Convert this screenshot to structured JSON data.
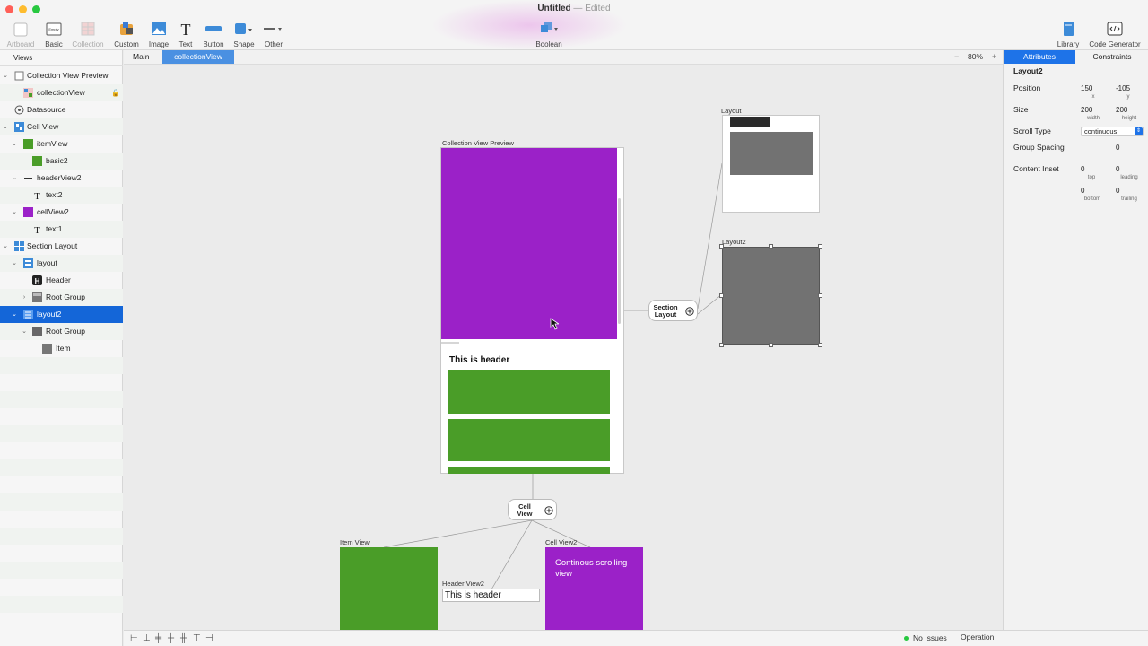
{
  "window": {
    "title": "Untitled",
    "title_sep": "—",
    "status": "Edited"
  },
  "toolbar": {
    "items": [
      {
        "label": "Artboard",
        "icon": "artboard-icon",
        "enabled": false
      },
      {
        "label": "Basic",
        "icon": "basic-icon",
        "enabled": true,
        "icon_text": "Empty"
      },
      {
        "label": "Collection",
        "icon": "collection-icon",
        "enabled": false
      },
      {
        "label": "Custom",
        "icon": "custom-icon",
        "enabled": true
      },
      {
        "label": "Image",
        "icon": "image-icon",
        "enabled": true
      },
      {
        "label": "Text",
        "icon": "text-icon",
        "enabled": true,
        "icon_text": "T"
      },
      {
        "label": "Button",
        "icon": "button-icon",
        "enabled": true
      },
      {
        "label": "Shape",
        "icon": "shape-icon",
        "enabled": true
      },
      {
        "label": "Other",
        "icon": "other-icon",
        "enabled": true
      }
    ],
    "boolean_label": "Boolean",
    "library_label": "Library",
    "codegen_label": "Code Generator"
  },
  "views_panel": {
    "tab_label": "Views",
    "items": [
      {
        "label": "Collection View Preview",
        "icon": "artboard-icon",
        "chevron": "v",
        "alt": false,
        "selected": false
      },
      {
        "label": "collectionView",
        "icon": "collection-icon",
        "lock": "🔒",
        "alt": true,
        "selected": false
      },
      {
        "label": "Datasource",
        "icon": "datasource-icon",
        "alt": false,
        "selected": false
      },
      {
        "label": "Cell View",
        "icon": "cellview-icon",
        "chevron": "v",
        "alt": true,
        "selected": false
      },
      {
        "label": "itemView",
        "icon": "green-square-icon",
        "chevron": "v",
        "alt": false,
        "selected": false
      },
      {
        "label": "basic2",
        "icon": "green-square-icon",
        "alt": true,
        "selected": false
      },
      {
        "label": "headerView2",
        "icon": "line-icon",
        "chevron": "v",
        "alt": false,
        "selected": false
      },
      {
        "label": "text2",
        "icon": "text-icon",
        "alt": true,
        "selected": false
      },
      {
        "label": "cellView2",
        "icon": "purple-square-icon",
        "chevron": "v",
        "alt": false,
        "selected": false
      },
      {
        "label": "text1",
        "icon": "text-icon",
        "alt": true,
        "selected": false
      },
      {
        "label": "Section Layout",
        "icon": "section-layout-icon",
        "chevron": "v",
        "alt": false,
        "selected": false
      },
      {
        "label": "layout",
        "icon": "layout-icon",
        "chevron": "v",
        "alt": true,
        "selected": false
      },
      {
        "label": "Header",
        "icon": "header-icon",
        "alt": false,
        "selected": false
      },
      {
        "label": "Root Group",
        "icon": "group-icon",
        "chevron": ">",
        "alt": true,
        "selected": false
      },
      {
        "label": "layout2",
        "icon": "layout2-icon",
        "chevron": "v",
        "alt": false,
        "selected": true
      },
      {
        "label": "Root Group",
        "icon": "group-gray-icon",
        "chevron": "v",
        "alt": true,
        "selected": false
      },
      {
        "label": "Item",
        "icon": "item-icon",
        "alt": false,
        "selected": false
      }
    ]
  },
  "doc_tabs": {
    "main": "Main",
    "collection": "collectionView",
    "zoom": "80%",
    "zoom_minus": "−",
    "zoom_plus": "+"
  },
  "canvas": {
    "collection_preview_label": "Collection  View  Preview",
    "header_text": "This is header",
    "layout_label": "Layout",
    "layout2_label": "Layout2",
    "section_layout_label_1": "Section",
    "section_layout_label_2": "Layout",
    "cell_view_label_1": "Cell",
    "cell_view_label_2": "View",
    "item_view_label": "Item View",
    "header_view2_label": "Header View2",
    "header_view2_text": "This is header",
    "cell_view2_label": "Cell View2",
    "cell_view2_text": "Continous scrolling view",
    "colors": {
      "purple": "#9b21c8",
      "green": "#4a9d28",
      "gray": "#727272",
      "dark": "#2b2b2b"
    }
  },
  "inspector": {
    "tab_attributes": "Attributes",
    "tab_constraints": "Constraints",
    "title": "Layout2",
    "position_label": "Position",
    "pos_x": "150",
    "pos_x_sub": "x",
    "pos_y": "-105",
    "pos_y_sub": "y",
    "size_label": "Size",
    "width": "200",
    "width_sub": "width",
    "height": "200",
    "height_sub": "height",
    "scroll_type_label": "Scroll Type",
    "scroll_type_value": "continuous",
    "group_spacing_label": "Group Spacing",
    "group_spacing_value": "0",
    "content_inset_label": "Content Inset",
    "inset_top": "0",
    "inset_top_sub": "top",
    "inset_leading": "0",
    "inset_leading_sub": "leading",
    "inset_bottom": "0",
    "inset_bottom_sub": "bottom",
    "inset_trailing": "0",
    "inset_trailing_sub": "trailing"
  },
  "status": {
    "issues": "No Issues",
    "operation": "Operation",
    "indicator_color": "#28c840"
  }
}
